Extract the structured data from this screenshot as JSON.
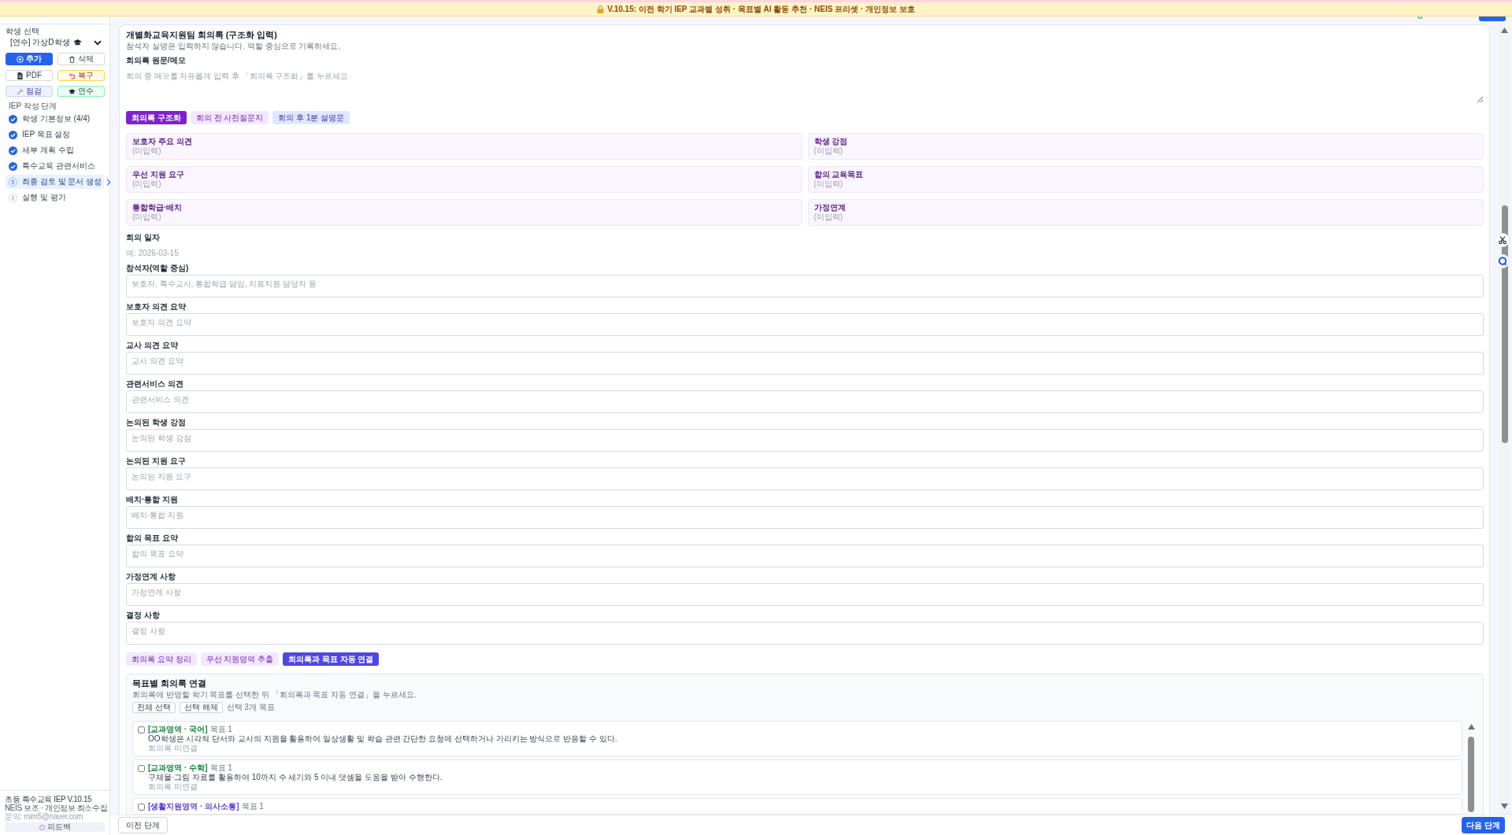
{
  "banner": {
    "text": "V.10.15: 이전 학기 IEP 교과별 성취 · 목표별 AI 활동 추천 · NEIS 프리셋 · 개인정보 보호"
  },
  "sidebar": {
    "student_select": {
      "label": "학생 선택",
      "value": "[연수] 가상D학생"
    },
    "buttons": [
      {
        "label": "추가",
        "kind": "add"
      },
      {
        "label": "삭제",
        "kind": "delete"
      },
      {
        "label": "PDF",
        "kind": "pdf"
      },
      {
        "label": "복구",
        "kind": "restore"
      },
      {
        "label": "점검",
        "kind": "inspect"
      },
      {
        "label": "연수",
        "kind": "training"
      }
    ],
    "steps_title": "IEP 작성 단계",
    "steps": [
      {
        "label": "학생 기본정보 (4/4)",
        "completed": true,
        "selected": false
      },
      {
        "label": "IEP 목표 설정",
        "completed": true,
        "selected": false
      },
      {
        "label": "세부 계획 수립",
        "completed": true,
        "selected": false
      },
      {
        "label": "특수교육 관련서비스",
        "completed": true,
        "selected": false
      },
      {
        "label": "최종 검토 및 문서 생성",
        "number": "5",
        "completed": false,
        "selected": true
      },
      {
        "label": "실행 및 평가",
        "number": "6",
        "completed": false,
        "selected": false
      }
    ],
    "footer": {
      "lines": [
        "초등 특수교육 IEP V.10.15",
        "NEIS 보조 · 개인정보 최소수집",
        "문의: mim5@naver.com"
      ],
      "feedback": "피드백"
    }
  },
  "meeting": {
    "title": "개별화교육지원팀 회의록 (구조화 입력)",
    "subtitle": "참석자 실명은 입력하지 않습니다. 역할 중심으로 기록하세요.",
    "memo": {
      "label": "회의록 원문/메모",
      "placeholder": "회의 중 메모를 자유롭게 입력 후 「회의록 구조화」를 누르세요"
    },
    "actions": [
      {
        "label": "회의록 구조화",
        "kind": "purple"
      },
      {
        "label": "회의 전 사전질문지",
        "kind": "lavender"
      },
      {
        "label": "회의 후 1분 설명문",
        "kind": "periwinkle"
      }
    ],
    "summary_cards": [
      {
        "title": "보호자 주요 의견",
        "value": "(미입력)"
      },
      {
        "title": "학생 강점",
        "value": "(미입력)"
      },
      {
        "title": "우선 지원 요구",
        "value": "(미입력)"
      },
      {
        "title": "합의 교육목표",
        "value": "(미입력)"
      },
      {
        "title": "통합학급·배치",
        "value": "(미입력)"
      },
      {
        "title": "가정연계",
        "value": "(미입력)"
      }
    ],
    "fields": [
      {
        "label": "회의 일자",
        "placeholder": "예: 2026-03-15",
        "kind": "plain"
      },
      {
        "label": "참석자(역할 중심)",
        "placeholder": "보호자, 특수교사, 통합학급 담임, 치료지원 담당자 등",
        "kind": "box"
      },
      {
        "label": "보호자 의견 요약",
        "placeholder": "보호자 의견 요약",
        "kind": "box"
      },
      {
        "label": "교사 의견 요약",
        "placeholder": "교사 의견 요약",
        "kind": "box"
      },
      {
        "label": "관련서비스 의견",
        "placeholder": "관련서비스 의견",
        "kind": "box"
      },
      {
        "label": "논의된 학생 강점",
        "placeholder": "논의된 학생 강점",
        "kind": "box"
      },
      {
        "label": "논의된 지원 요구",
        "placeholder": "논의된 지원 요구",
        "kind": "box"
      },
      {
        "label": "배치·통합 지원",
        "placeholder": "배치·통합 지원",
        "kind": "box"
      },
      {
        "label": "합의 목표 요약",
        "placeholder": "합의 목표 요약",
        "kind": "box"
      },
      {
        "label": "가정연계 사항",
        "placeholder": "가정연계 사항",
        "kind": "box"
      },
      {
        "label": "결정 사항",
        "placeholder": "결정 사항",
        "kind": "box"
      }
    ],
    "tools": [
      {
        "label": "회의록 요약 정리",
        "kind": "lavender"
      },
      {
        "label": "우선 지원영역 추출",
        "kind": "lavender"
      },
      {
        "label": "회의록과 목표 자동 연결",
        "kind": "indigo"
      }
    ],
    "goal_links": {
      "title": "목표별 회의록 연결",
      "description": "회의록에 반영할 학기 목표를 선택한 뒤 「회의록과 목표 자동 연결」을 누르세요.",
      "buttons": [
        "전체 선택",
        "선택 해제"
      ],
      "count": "선택 3개 목표",
      "goals": [
        {
          "area": "[교과영역 · 국어]",
          "color": "#15803d",
          "number": "목표 1",
          "text": "OO학생은 시각적 단서와 교사의 지원을 활용하여 일상생활 및 학습 관련 간단한 요청에 선택하거나 가리키는 방식으로 반응할 수 있다.",
          "status": "회의록 미연결",
          "checked": false
        },
        {
          "area": "[교과영역 · 수학]",
          "color": "#15803d",
          "number": "목표 1",
          "text": "구체물·그림 자료를 활용하여 10까지 수 세기와 5 이내 덧셈을 도움을 받아 수행한다.",
          "status": "회의록 미연결",
          "checked": false
        },
        {
          "area": "[생활지원영역 · 의사소통]",
          "color": "#5b3fd0",
          "number": "목표 1",
          "checked": false
        }
      ]
    }
  },
  "footer": {
    "previous": "이전 단계",
    "next": "다음 단계"
  }
}
